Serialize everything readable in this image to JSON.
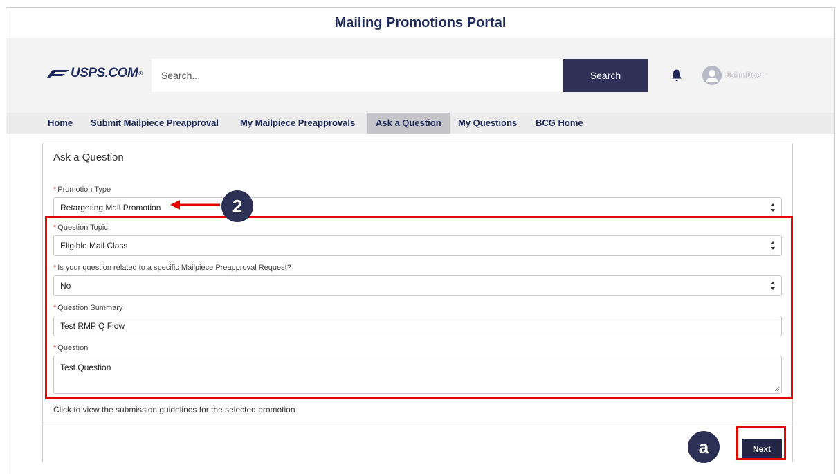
{
  "portal": {
    "title": "Mailing Promotions Portal"
  },
  "header": {
    "logo_text": "USPS.COM",
    "search_placeholder": "Search...",
    "search_button": "Search",
    "user_name": "John.Doe",
    "icons": {
      "logo": "usps-eagle-icon",
      "notifications": "bell-icon",
      "avatar": "user-avatar-icon",
      "menu": "chevron-down-icon"
    }
  },
  "nav": {
    "items": [
      {
        "label": "Home",
        "active": false
      },
      {
        "label": "Submit Mailpiece Preapproval",
        "active": false
      },
      {
        "label": "My Mailpiece Preapprovals",
        "active": false
      },
      {
        "label": "Ask a Question",
        "active": true
      },
      {
        "label": "My Questions",
        "active": false
      },
      {
        "label": "BCG Home",
        "active": false
      }
    ]
  },
  "form": {
    "title": "Ask a Question",
    "promotion_type": {
      "label": "Promotion Type",
      "value": "Retargeting Mail Promotion"
    },
    "question_topic": {
      "label": "Question Topic",
      "value": "Eligible Mail Class"
    },
    "related_request": {
      "label": "Is your question related to a specific Mailpiece Preapproval Request?",
      "value": "No"
    },
    "question_summary": {
      "label": "Question Summary",
      "value": "Test RMP Q Flow"
    },
    "question": {
      "label": "Question",
      "value": "Test Question"
    },
    "guidelines_text": "Click to view the submission guidelines for the selected promotion",
    "next_button": "Next"
  },
  "annotations": {
    "step_badge": "2",
    "action_badge": "a"
  },
  "colors": {
    "brand_navy": "#1f2a5a",
    "button_navy": "#2e3058",
    "required": "#c23934",
    "annotation_red": "#e10600"
  }
}
